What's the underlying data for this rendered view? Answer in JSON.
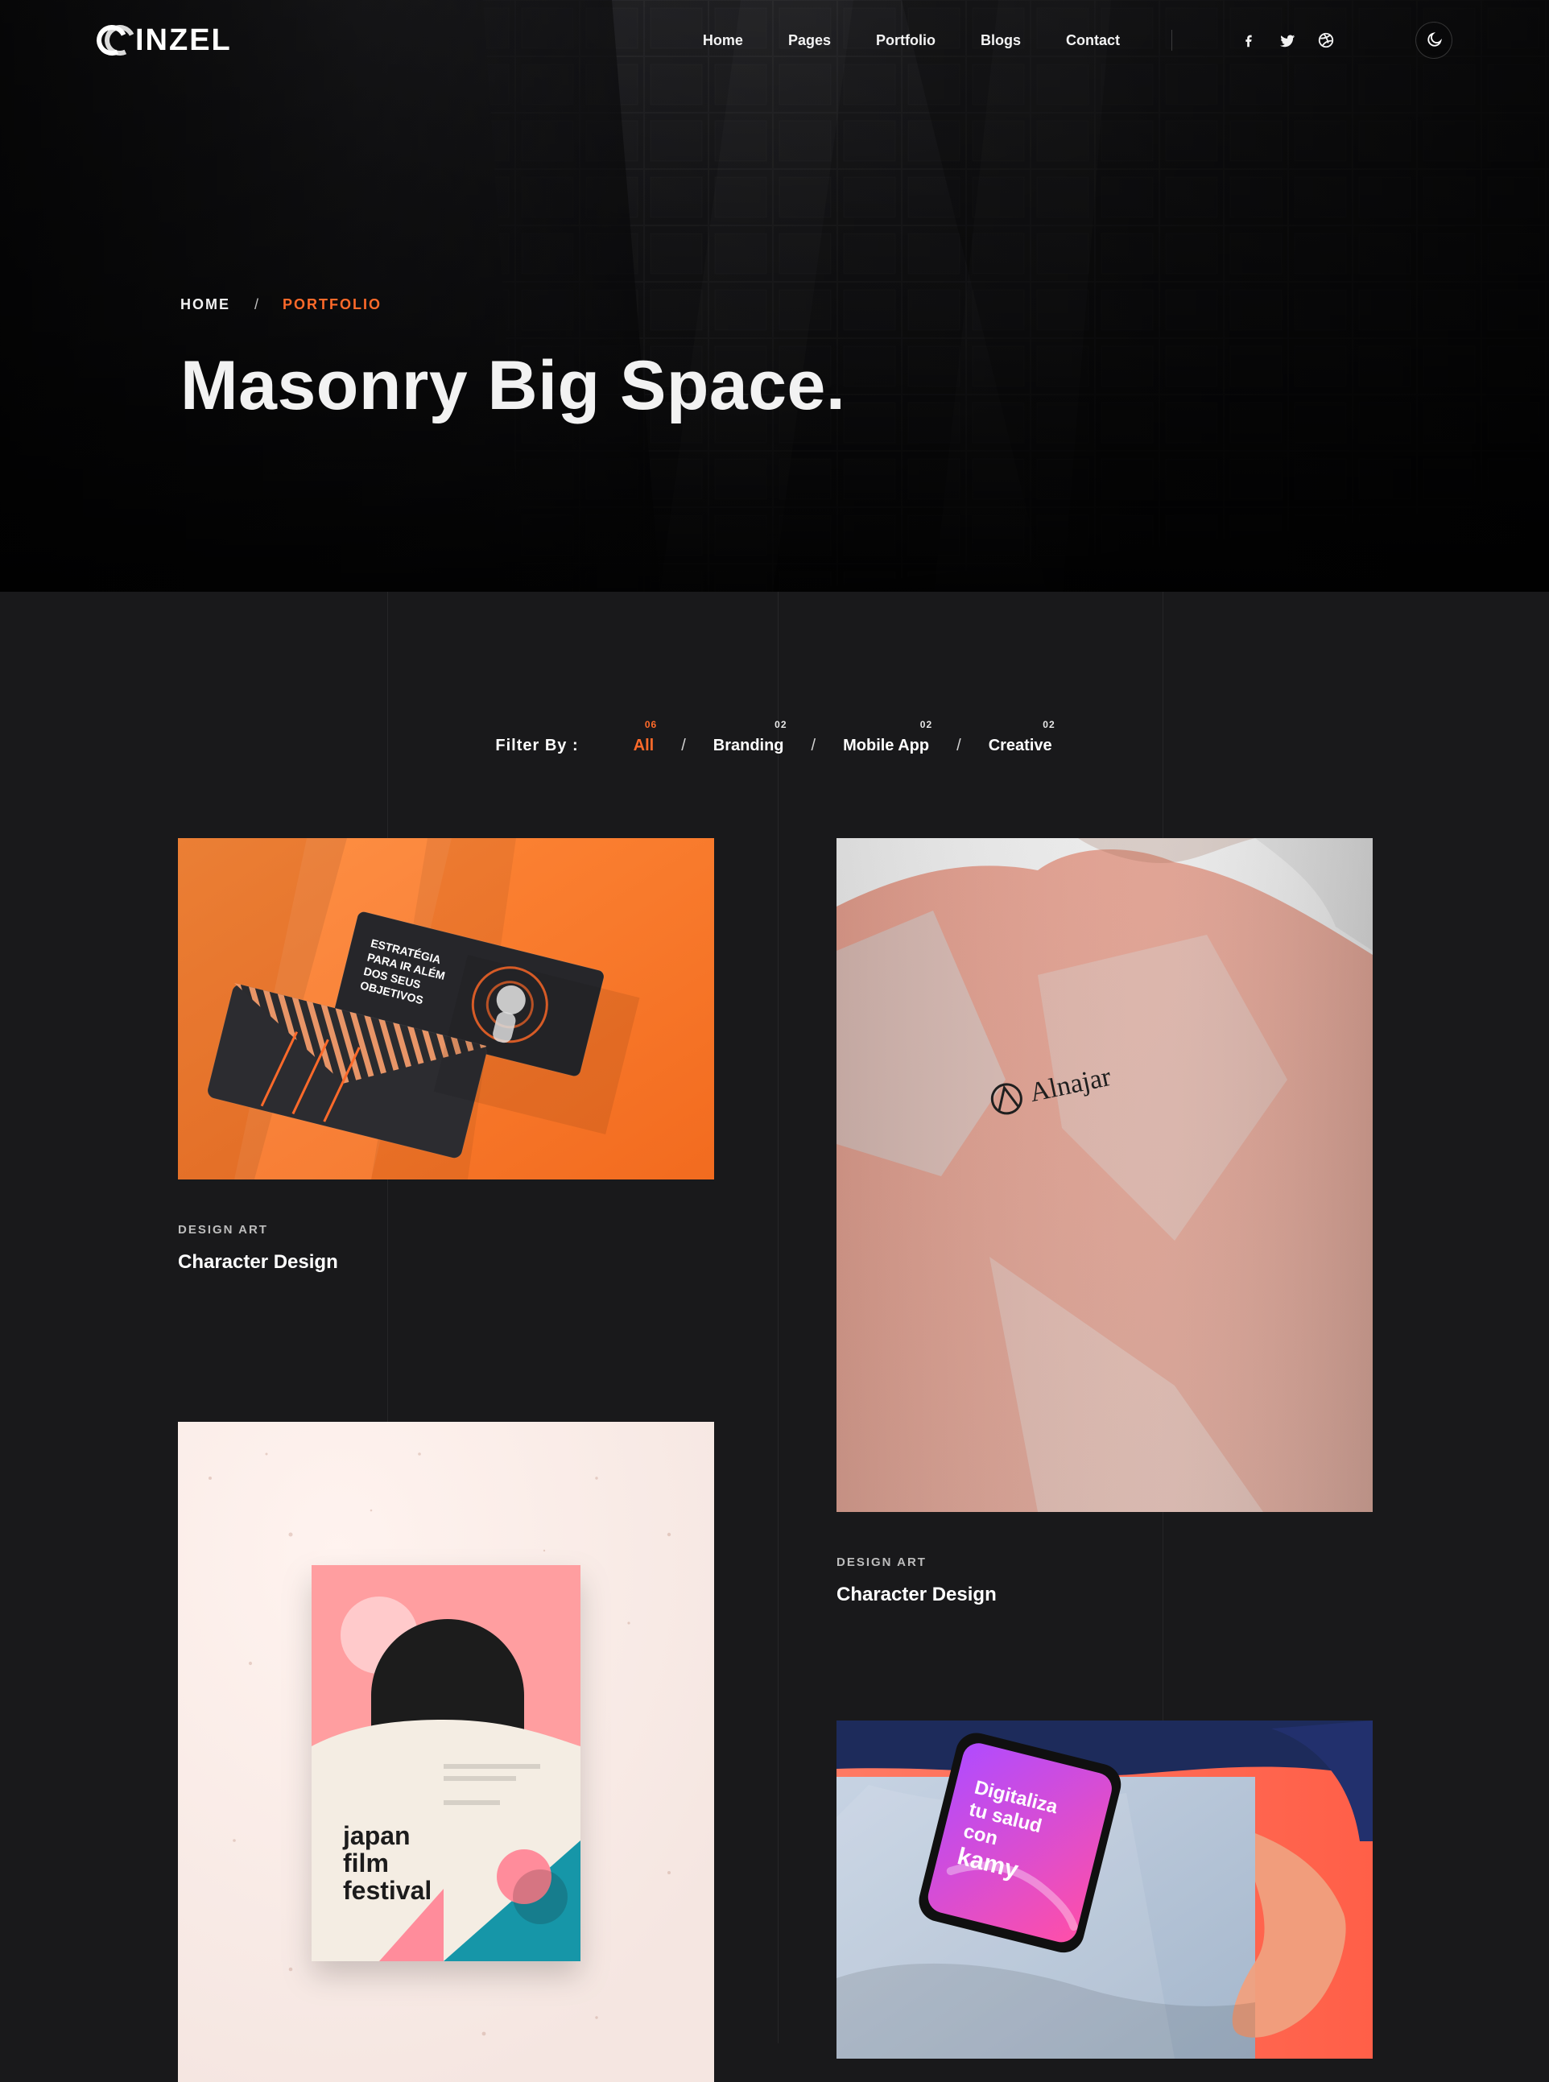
{
  "brand": {
    "name": "INZEL"
  },
  "nav": {
    "items": [
      "Home",
      "Pages",
      "Portfolio",
      "Blogs",
      "Contact"
    ],
    "social_icons": [
      "facebook-icon",
      "twitter-icon",
      "dribbble-icon"
    ],
    "theme_icon": "moon-icon"
  },
  "hero": {
    "breadcrumb": {
      "home": "HOME",
      "separator": "/",
      "current": "PORTFOLIO"
    },
    "title": "Masonry Big Space."
  },
  "filter": {
    "label": "Filter By :",
    "items": [
      {
        "label": "All",
        "count": "06",
        "active": true
      },
      {
        "label": "Branding",
        "count": "02",
        "active": false
      },
      {
        "label": "Mobile App",
        "count": "02",
        "active": false
      },
      {
        "label": "Creative",
        "count": "02",
        "active": false
      }
    ],
    "separator": "/"
  },
  "portfolio": {
    "cards": [
      {
        "category": "DESIGN ART",
        "title": "Character Design",
        "image": {
          "headline": "ESTRATÉGIA\nPARA IR ALÉM\nDOS SEUS\nOBJETIVOS"
        }
      },
      {
        "category": "DESIGN ART",
        "title": "Character Design",
        "image": {
          "brand": "Alnajar"
        }
      },
      {
        "image": {
          "poster_title": "japan\nfilm\nfestival"
        }
      },
      {
        "image": {
          "phone_text": "Digitaliza\ntu salud\ncon\nkamy"
        }
      }
    ]
  },
  "colors": {
    "accent": "#ff6a2a",
    "background": "#19191b"
  }
}
